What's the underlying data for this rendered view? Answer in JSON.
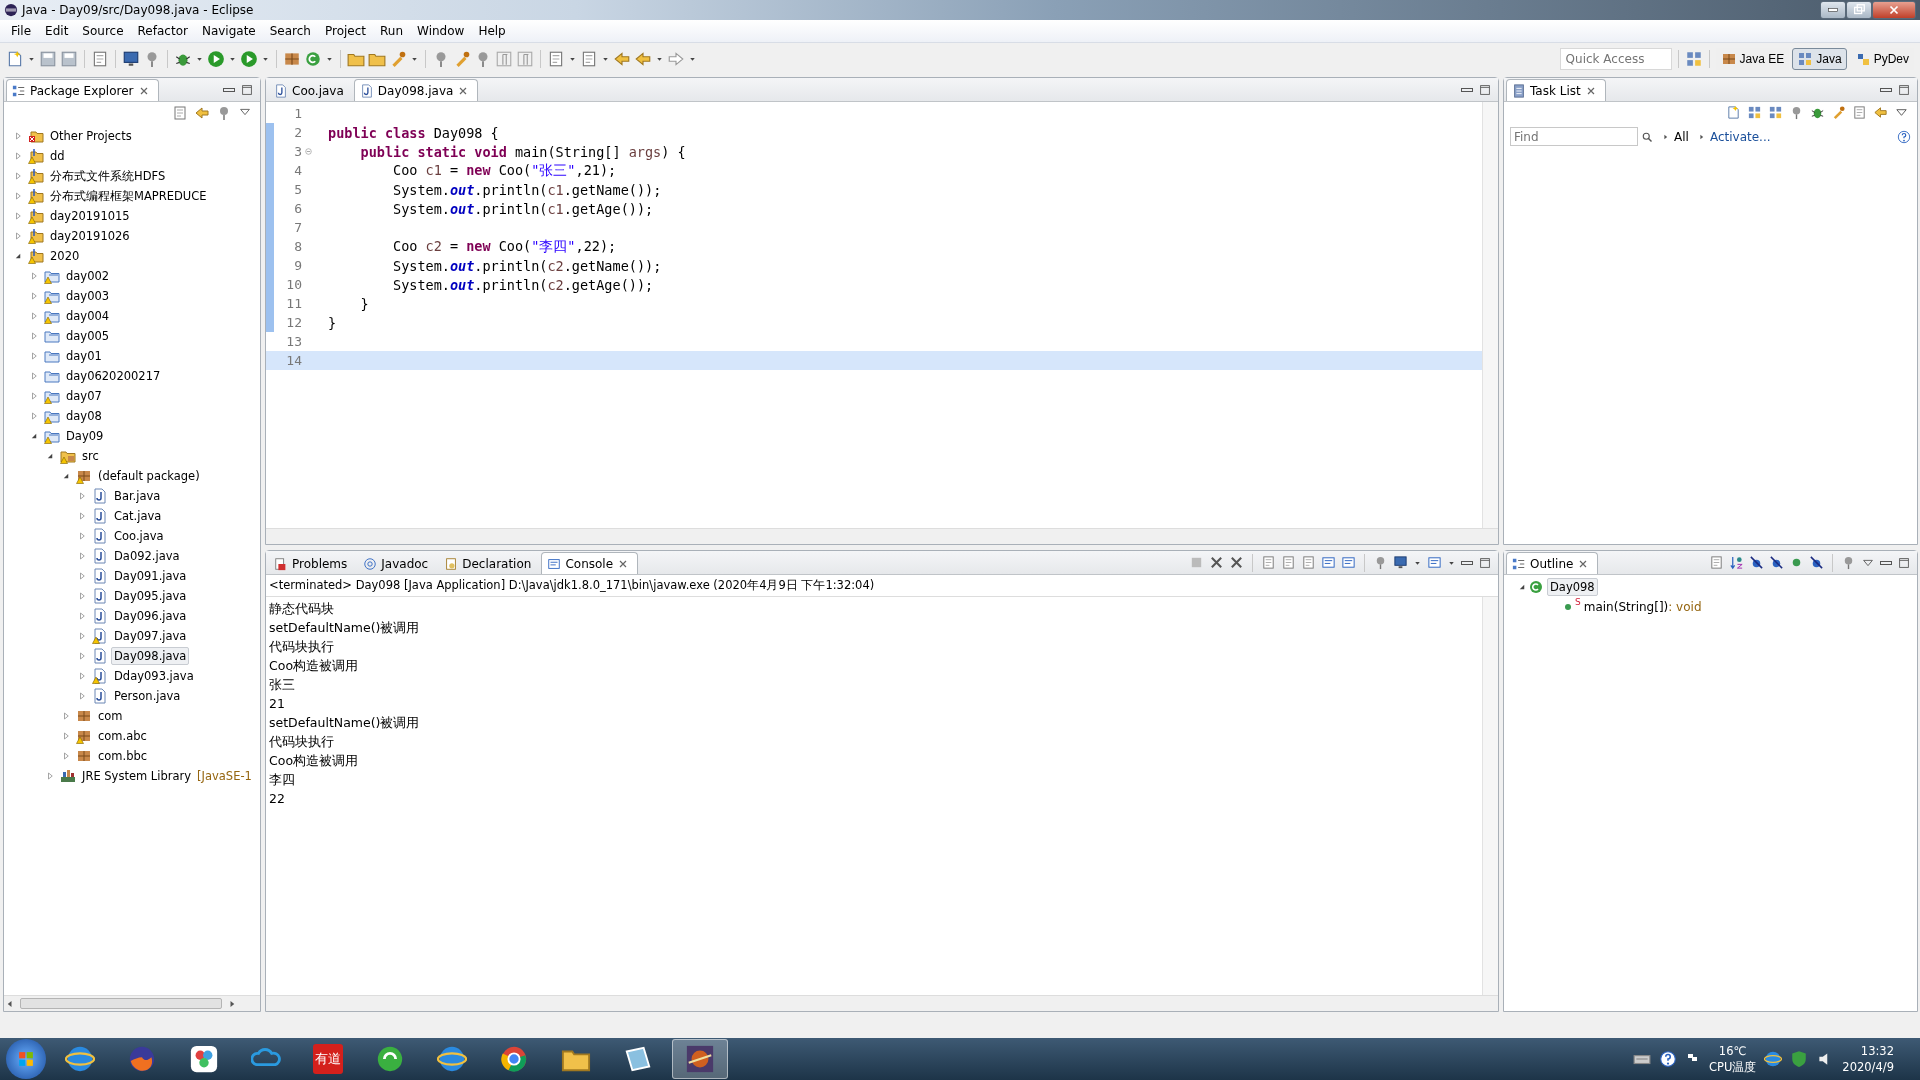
{
  "window": {
    "title": "Java - Day09/src/Day098.java - Eclipse"
  },
  "menu": [
    "File",
    "Edit",
    "Source",
    "Refactor",
    "Navigate",
    "Search",
    "Project",
    "Run",
    "Window",
    "Help"
  ],
  "quick_access": {
    "placeholder": "Quick Access"
  },
  "perspectives": [
    {
      "label": "Java EE",
      "selected": false
    },
    {
      "label": "Java",
      "selected": true
    },
    {
      "label": "PyDev",
      "selected": false
    }
  ],
  "package_explorer": {
    "title": "Package Explorer",
    "tree": [
      {
        "label": "Other Projects",
        "kind": "broken-set",
        "expanded": false,
        "warning": false,
        "selected": false
      },
      {
        "label": "dd",
        "kind": "working-set",
        "expanded": false,
        "warning": true,
        "selected": false
      },
      {
        "label": "分布式文件系统HDFS",
        "kind": "working-set",
        "expanded": false,
        "warning": true,
        "selected": false
      },
      {
        "label": "分布式编程框架MAPREDUCE",
        "kind": "working-set",
        "expanded": false,
        "warning": true,
        "selected": false
      },
      {
        "label": "day20191015",
        "kind": "working-set",
        "expanded": false,
        "warning": true,
        "selected": false
      },
      {
        "label": "day20191026",
        "kind": "working-set",
        "expanded": false,
        "warning": true,
        "selected": false
      },
      {
        "label": "2020",
        "kind": "working-set",
        "expanded": true,
        "warning": true,
        "selected": false,
        "children": [
          {
            "label": "day002",
            "kind": "project",
            "expanded": false,
            "warning": true,
            "selected": false
          },
          {
            "label": "day003",
            "kind": "project",
            "expanded": false,
            "warning": true,
            "selected": false
          },
          {
            "label": "day004",
            "kind": "project",
            "expanded": false,
            "warning": true,
            "selected": false
          },
          {
            "label": "day005",
            "kind": "project",
            "expanded": false,
            "warning": false,
            "selected": false
          },
          {
            "label": "day01",
            "kind": "project",
            "expanded": false,
            "warning": false,
            "selected": false
          },
          {
            "label": "day0620200217",
            "kind": "project",
            "expanded": false,
            "warning": false,
            "selected": false
          },
          {
            "label": "day07",
            "kind": "project",
            "expanded": false,
            "warning": true,
            "selected": false
          },
          {
            "label": "day08",
            "kind": "project",
            "expanded": false,
            "warning": true,
            "selected": false
          },
          {
            "label": "Day09",
            "kind": "project",
            "expanded": true,
            "warning": true,
            "selected": false,
            "children": [
              {
                "label": "src",
                "kind": "source-folder",
                "expanded": true,
                "warning": true,
                "selected": false,
                "children": [
                  {
                    "label": "(default package)",
                    "kind": "package",
                    "expanded": true,
                    "warning": true,
                    "selected": false,
                    "children": [
                      {
                        "label": "Bar.java",
                        "kind": "java-file",
                        "expanded": false,
                        "warning": false,
                        "selected": false
                      },
                      {
                        "label": "Cat.java",
                        "kind": "java-file",
                        "expanded": false,
                        "warning": false,
                        "selected": false
                      },
                      {
                        "label": "Coo.java",
                        "kind": "java-file",
                        "expanded": false,
                        "warning": false,
                        "selected": false
                      },
                      {
                        "label": "Da092.java",
                        "kind": "java-file",
                        "expanded": false,
                        "warning": false,
                        "selected": false
                      },
                      {
                        "label": "Day091.java",
                        "kind": "java-file",
                        "expanded": false,
                        "warning": false,
                        "selected": false
                      },
                      {
                        "label": "Day095.java",
                        "kind": "java-file",
                        "expanded": false,
                        "warning": false,
                        "selected": false
                      },
                      {
                        "label": "Day096.java",
                        "kind": "java-file",
                        "expanded": false,
                        "warning": false,
                        "selected": false
                      },
                      {
                        "label": "Day097.java",
                        "kind": "java-file",
                        "expanded": false,
                        "warning": true,
                        "selected": false
                      },
                      {
                        "label": "Day098.java",
                        "kind": "java-file",
                        "expanded": false,
                        "warning": false,
                        "selected": true
                      },
                      {
                        "label": "Dday093.java",
                        "kind": "java-file",
                        "expanded": false,
                        "warning": true,
                        "selected": false
                      },
                      {
                        "label": "Person.java",
                        "kind": "java-file",
                        "expanded": false,
                        "warning": false,
                        "selected": false
                      }
                    ]
                  },
                  {
                    "label": "com",
                    "kind": "package",
                    "expanded": false,
                    "warning": false,
                    "selected": false
                  },
                  {
                    "label": "com.abc",
                    "kind": "package",
                    "expanded": false,
                    "warning": true,
                    "selected": false
                  },
                  {
                    "label": "com.bbc",
                    "kind": "package",
                    "expanded": false,
                    "warning": false,
                    "selected": false
                  }
                ]
              },
              {
                "label": "JRE System Library",
                "suffix": "[JavaSE-1",
                "kind": "library",
                "expanded": false,
                "warning": false,
                "selected": false
              }
            ]
          }
        ]
      }
    ]
  },
  "editor": {
    "tabs": [
      {
        "label": "Coo.java",
        "selected": false
      },
      {
        "label": "Day098.java",
        "selected": true
      }
    ],
    "lines": [
      {
        "number": "1",
        "changed": false,
        "fold": false,
        "current": false
      },
      {
        "number": "2",
        "changed": true,
        "fold": false,
        "current": false,
        "segments": [
          {
            "kind": "keyword",
            "text": "public class"
          },
          {
            "kind": "plain",
            "text": " Day098 {"
          }
        ]
      },
      {
        "number": "3",
        "changed": true,
        "fold": true,
        "current": false,
        "segments": [
          {
            "kind": "keyword",
            "text": "    public static void"
          },
          {
            "kind": "plain",
            "text": " main(String[] "
          },
          {
            "kind": "local",
            "text": "args"
          },
          {
            "kind": "plain",
            "text": ") {"
          }
        ]
      },
      {
        "number": "4",
        "changed": true,
        "fold": false,
        "current": false,
        "segments": [
          {
            "kind": "plain",
            "text": "        Coo "
          },
          {
            "kind": "local",
            "text": "c1"
          },
          {
            "kind": "plain",
            "text": " = "
          },
          {
            "kind": "keyword",
            "text": "new"
          },
          {
            "kind": "plain",
            "text": " Coo("
          },
          {
            "kind": "string",
            "text": "\"张三\""
          },
          {
            "kind": "plain",
            "text": ",21);"
          }
        ]
      },
      {
        "number": "5",
        "changed": true,
        "fold": false,
        "current": false,
        "segments": [
          {
            "kind": "plain",
            "text": "        System."
          },
          {
            "kind": "field",
            "text": "out"
          },
          {
            "kind": "plain",
            "text": ".println("
          },
          {
            "kind": "local",
            "text": "c1"
          },
          {
            "kind": "plain",
            "text": ".getName());"
          }
        ]
      },
      {
        "number": "6",
        "changed": true,
        "fold": false,
        "current": false,
        "segments": [
          {
            "kind": "plain",
            "text": "        System."
          },
          {
            "kind": "field",
            "text": "out"
          },
          {
            "kind": "plain",
            "text": ".println("
          },
          {
            "kind": "local",
            "text": "c1"
          },
          {
            "kind": "plain",
            "text": ".getAge());"
          }
        ]
      },
      {
        "number": "7",
        "changed": true,
        "fold": false,
        "current": false
      },
      {
        "number": "8",
        "changed": true,
        "fold": false,
        "current": false,
        "segments": [
          {
            "kind": "plain",
            "text": "        Coo "
          },
          {
            "kind": "local",
            "text": "c2"
          },
          {
            "kind": "plain",
            "text": " = "
          },
          {
            "kind": "keyword",
            "text": "new"
          },
          {
            "kind": "plain",
            "text": " Coo("
          },
          {
            "kind": "string",
            "text": "\"李四\""
          },
          {
            "kind": "plain",
            "text": ",22);"
          }
        ]
      },
      {
        "number": "9",
        "changed": true,
        "fold": false,
        "current": false,
        "segments": [
          {
            "kind": "plain",
            "text": "        System."
          },
          {
            "kind": "field",
            "text": "out"
          },
          {
            "kind": "plain",
            "text": ".println("
          },
          {
            "kind": "local",
            "text": "c2"
          },
          {
            "kind": "plain",
            "text": ".getName());"
          }
        ]
      },
      {
        "number": "10",
        "changed": true,
        "fold": false,
        "current": false,
        "segments": [
          {
            "kind": "plain",
            "text": "        System."
          },
          {
            "kind": "field",
            "text": "out"
          },
          {
            "kind": "plain",
            "text": ".println("
          },
          {
            "kind": "local",
            "text": "c2"
          },
          {
            "kind": "plain",
            "text": ".getAge());"
          }
        ]
      },
      {
        "number": "11",
        "changed": true,
        "fold": false,
        "current": false,
        "segments": [
          {
            "kind": "plain",
            "text": "    }"
          }
        ]
      },
      {
        "number": "12",
        "changed": true,
        "fold": false,
        "current": false,
        "segments": [
          {
            "kind": "plain",
            "text": "}"
          }
        ]
      },
      {
        "number": "13",
        "changed": false,
        "fold": false,
        "current": false
      },
      {
        "number": "14",
        "changed": false,
        "fold": false,
        "current": true
      }
    ]
  },
  "bottom_panel": {
    "tabs": [
      {
        "label": "Problems",
        "selected": false
      },
      {
        "label": "Javadoc",
        "selected": false
      },
      {
        "label": "Declaration",
        "selected": false
      },
      {
        "label": "Console",
        "selected": true
      }
    ],
    "console_header": "<terminated> Day098 [Java Application] D:\\Java\\jdk1.8.0_171\\bin\\javaw.exe (2020年4月9日 下午1:32:04)",
    "console_lines": [
      "静态代码块",
      "setDefaultName()被调用",
      "代码块执行",
      "Coo构造被调用",
      "张三",
      "21",
      "setDefaultName()被调用",
      "代码块执行",
      "Coo构造被调用",
      "李四",
      "22"
    ]
  },
  "task_list": {
    "title": "Task List",
    "find": {
      "placeholder": "Find"
    },
    "links": [
      "All",
      "Activate..."
    ]
  },
  "outline": {
    "title": "Outline",
    "class_name": "Day098",
    "members": [
      {
        "name": "main(String[])",
        "modifier": "S",
        "type": " : void"
      }
    ]
  },
  "taskbar": {
    "apps": [
      {
        "kind": "globe",
        "active": false
      },
      {
        "kind": "flame",
        "active": false
      },
      {
        "kind": "flower",
        "active": false
      },
      {
        "kind": "cloud",
        "active": false
      },
      {
        "kind": "tile",
        "text": "有道",
        "active": false
      },
      {
        "kind": "refresh",
        "active": false
      },
      {
        "kind": "globe",
        "active": false
      },
      {
        "kind": "wheel",
        "active": false
      },
      {
        "kind": "folder",
        "active": false
      },
      {
        "kind": "notebook",
        "active": false
      },
      {
        "kind": "planet",
        "active": true
      }
    ],
    "temperature": "16℃",
    "cpu_label": "CPU温度",
    "time": "13:32",
    "date": "2020/4/9"
  }
}
